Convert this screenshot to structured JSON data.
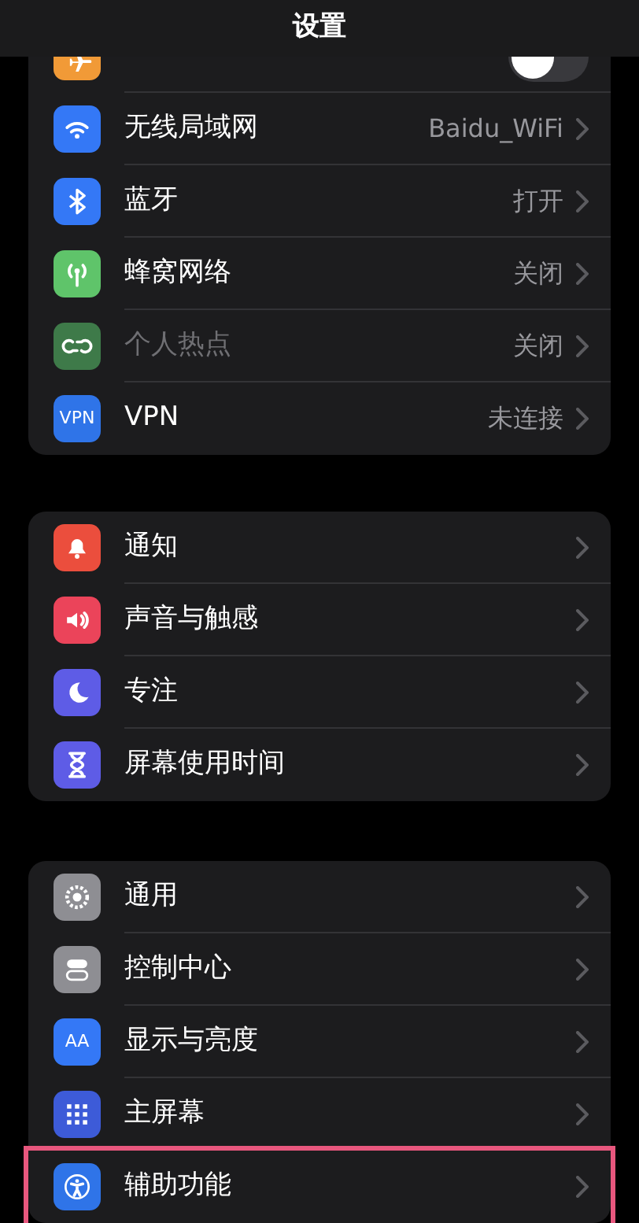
{
  "title": "设置",
  "groups": [
    {
      "rows": [
        {
          "kind": "toggle",
          "on": false,
          "color": "#f19a37"
        },
        {
          "kind": "link",
          "label": "无线局域网",
          "value": "Baidu_WiFi",
          "color": "#3478f6",
          "disabled": false,
          "highlighted": false
        },
        {
          "kind": "link",
          "label": "蓝牙",
          "value": "打开",
          "color": "#3478f6",
          "disabled": false,
          "highlighted": false
        },
        {
          "kind": "link",
          "label": "蜂窝网络",
          "value": "关闭",
          "color": "#5fc46a",
          "disabled": false,
          "highlighted": false
        },
        {
          "kind": "link",
          "label": "个人热点",
          "value": "关闭",
          "color": "#3e7a49",
          "disabled": true,
          "highlighted": false
        },
        {
          "kind": "link",
          "label": "VPN",
          "value": "未连接",
          "icon_text": "VPN",
          "color": "#2f74e8",
          "disabled": false,
          "highlighted": false
        }
      ]
    },
    {
      "rows": [
        {
          "kind": "link",
          "label": "通知",
          "color": "#eb4e3d",
          "disabled": false,
          "highlighted": false
        },
        {
          "kind": "link",
          "label": "声音与触感",
          "color": "#eb445a",
          "disabled": false,
          "highlighted": false
        },
        {
          "kind": "link",
          "label": "专注",
          "color": "#5e5ce6",
          "disabled": false,
          "highlighted": false
        },
        {
          "kind": "link",
          "label": "屏幕使用时间",
          "color": "#5e5ce6",
          "disabled": false,
          "highlighted": false
        }
      ]
    },
    {
      "rows": [
        {
          "kind": "link",
          "label": "通用",
          "color": "#8e8e93",
          "disabled": false,
          "highlighted": false
        },
        {
          "kind": "link",
          "label": "控制中心",
          "color": "#8e8e93",
          "disabled": false,
          "highlighted": false
        },
        {
          "kind": "link",
          "label": "显示与亮度",
          "icon_text": "AA",
          "color": "#3478f6",
          "disabled": false,
          "highlighted": false
        },
        {
          "kind": "link",
          "label": "主屏幕",
          "color": "#3d5bd8",
          "disabled": false,
          "highlighted": false
        },
        {
          "kind": "link",
          "label": "辅助功能",
          "color": "#2f74e8",
          "disabled": false,
          "highlighted": true
        }
      ]
    }
  ]
}
